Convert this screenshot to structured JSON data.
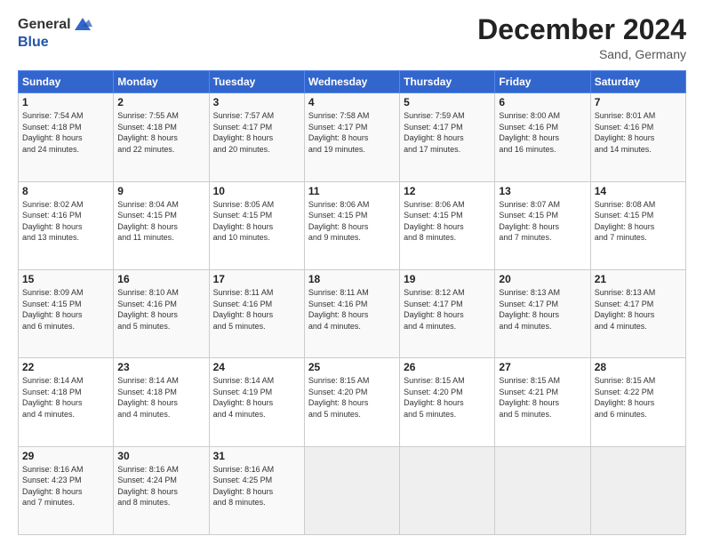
{
  "header": {
    "logo_general": "General",
    "logo_blue": "Blue",
    "month_title": "December 2024",
    "location": "Sand, Germany"
  },
  "days_of_week": [
    "Sunday",
    "Monday",
    "Tuesday",
    "Wednesday",
    "Thursday",
    "Friday",
    "Saturday"
  ],
  "weeks": [
    [
      {
        "day": "1",
        "lines": [
          "Sunrise: 7:54 AM",
          "Sunset: 4:18 PM",
          "Daylight: 8 hours",
          "and 24 minutes."
        ]
      },
      {
        "day": "2",
        "lines": [
          "Sunrise: 7:55 AM",
          "Sunset: 4:18 PM",
          "Daylight: 8 hours",
          "and 22 minutes."
        ]
      },
      {
        "day": "3",
        "lines": [
          "Sunrise: 7:57 AM",
          "Sunset: 4:17 PM",
          "Daylight: 8 hours",
          "and 20 minutes."
        ]
      },
      {
        "day": "4",
        "lines": [
          "Sunrise: 7:58 AM",
          "Sunset: 4:17 PM",
          "Daylight: 8 hours",
          "and 19 minutes."
        ]
      },
      {
        "day": "5",
        "lines": [
          "Sunrise: 7:59 AM",
          "Sunset: 4:17 PM",
          "Daylight: 8 hours",
          "and 17 minutes."
        ]
      },
      {
        "day": "6",
        "lines": [
          "Sunrise: 8:00 AM",
          "Sunset: 4:16 PM",
          "Daylight: 8 hours",
          "and 16 minutes."
        ]
      },
      {
        "day": "7",
        "lines": [
          "Sunrise: 8:01 AM",
          "Sunset: 4:16 PM",
          "Daylight: 8 hours",
          "and 14 minutes."
        ]
      }
    ],
    [
      {
        "day": "8",
        "lines": [
          "Sunrise: 8:02 AM",
          "Sunset: 4:16 PM",
          "Daylight: 8 hours",
          "and 13 minutes."
        ]
      },
      {
        "day": "9",
        "lines": [
          "Sunrise: 8:04 AM",
          "Sunset: 4:15 PM",
          "Daylight: 8 hours",
          "and 11 minutes."
        ]
      },
      {
        "day": "10",
        "lines": [
          "Sunrise: 8:05 AM",
          "Sunset: 4:15 PM",
          "Daylight: 8 hours",
          "and 10 minutes."
        ]
      },
      {
        "day": "11",
        "lines": [
          "Sunrise: 8:06 AM",
          "Sunset: 4:15 PM",
          "Daylight: 8 hours",
          "and 9 minutes."
        ]
      },
      {
        "day": "12",
        "lines": [
          "Sunrise: 8:06 AM",
          "Sunset: 4:15 PM",
          "Daylight: 8 hours",
          "and 8 minutes."
        ]
      },
      {
        "day": "13",
        "lines": [
          "Sunrise: 8:07 AM",
          "Sunset: 4:15 PM",
          "Daylight: 8 hours",
          "and 7 minutes."
        ]
      },
      {
        "day": "14",
        "lines": [
          "Sunrise: 8:08 AM",
          "Sunset: 4:15 PM",
          "Daylight: 8 hours",
          "and 7 minutes."
        ]
      }
    ],
    [
      {
        "day": "15",
        "lines": [
          "Sunrise: 8:09 AM",
          "Sunset: 4:15 PM",
          "Daylight: 8 hours",
          "and 6 minutes."
        ]
      },
      {
        "day": "16",
        "lines": [
          "Sunrise: 8:10 AM",
          "Sunset: 4:16 PM",
          "Daylight: 8 hours",
          "and 5 minutes."
        ]
      },
      {
        "day": "17",
        "lines": [
          "Sunrise: 8:11 AM",
          "Sunset: 4:16 PM",
          "Daylight: 8 hours",
          "and 5 minutes."
        ]
      },
      {
        "day": "18",
        "lines": [
          "Sunrise: 8:11 AM",
          "Sunset: 4:16 PM",
          "Daylight: 8 hours",
          "and 4 minutes."
        ]
      },
      {
        "day": "19",
        "lines": [
          "Sunrise: 8:12 AM",
          "Sunset: 4:17 PM",
          "Daylight: 8 hours",
          "and 4 minutes."
        ]
      },
      {
        "day": "20",
        "lines": [
          "Sunrise: 8:13 AM",
          "Sunset: 4:17 PM",
          "Daylight: 8 hours",
          "and 4 minutes."
        ]
      },
      {
        "day": "21",
        "lines": [
          "Sunrise: 8:13 AM",
          "Sunset: 4:17 PM",
          "Daylight: 8 hours",
          "and 4 minutes."
        ]
      }
    ],
    [
      {
        "day": "22",
        "lines": [
          "Sunrise: 8:14 AM",
          "Sunset: 4:18 PM",
          "Daylight: 8 hours",
          "and 4 minutes."
        ]
      },
      {
        "day": "23",
        "lines": [
          "Sunrise: 8:14 AM",
          "Sunset: 4:18 PM",
          "Daylight: 8 hours",
          "and 4 minutes."
        ]
      },
      {
        "day": "24",
        "lines": [
          "Sunrise: 8:14 AM",
          "Sunset: 4:19 PM",
          "Daylight: 8 hours",
          "and 4 minutes."
        ]
      },
      {
        "day": "25",
        "lines": [
          "Sunrise: 8:15 AM",
          "Sunset: 4:20 PM",
          "Daylight: 8 hours",
          "and 5 minutes."
        ]
      },
      {
        "day": "26",
        "lines": [
          "Sunrise: 8:15 AM",
          "Sunset: 4:20 PM",
          "Daylight: 8 hours",
          "and 5 minutes."
        ]
      },
      {
        "day": "27",
        "lines": [
          "Sunrise: 8:15 AM",
          "Sunset: 4:21 PM",
          "Daylight: 8 hours",
          "and 5 minutes."
        ]
      },
      {
        "day": "28",
        "lines": [
          "Sunrise: 8:15 AM",
          "Sunset: 4:22 PM",
          "Daylight: 8 hours",
          "and 6 minutes."
        ]
      }
    ],
    [
      {
        "day": "29",
        "lines": [
          "Sunrise: 8:16 AM",
          "Sunset: 4:23 PM",
          "Daylight: 8 hours",
          "and 7 minutes."
        ]
      },
      {
        "day": "30",
        "lines": [
          "Sunrise: 8:16 AM",
          "Sunset: 4:24 PM",
          "Daylight: 8 hours",
          "and 8 minutes."
        ]
      },
      {
        "day": "31",
        "lines": [
          "Sunrise: 8:16 AM",
          "Sunset: 4:25 PM",
          "Daylight: 8 hours",
          "and 8 minutes."
        ]
      },
      {
        "day": "",
        "lines": []
      },
      {
        "day": "",
        "lines": []
      },
      {
        "day": "",
        "lines": []
      },
      {
        "day": "",
        "lines": []
      }
    ]
  ]
}
